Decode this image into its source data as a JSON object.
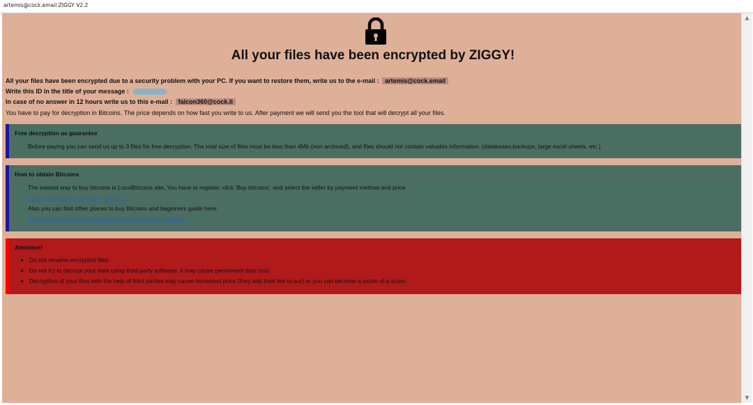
{
  "window": {
    "title": "artemis@cock.email ZIGGY V2.2"
  },
  "header": {
    "lock_icon": "padlock-icon",
    "headline": "All your files have been encrypted by ZIGGY!"
  },
  "intro": {
    "line1_text": "All your files have been encrypted due to a security problem with your PC. If you want to restore them, write us to the e-mail :",
    "line1_email": "artemis@cock.email",
    "line2_text": "Write this ID in the title of your message :",
    "line3_text": "In case of no answer in 12 hours write us to this e-mail :",
    "line3_email": "falcon360@cock.li",
    "line4_text": "You have to pay for decryption in Bitcoins. The price depends on how fast you write to us. After payment we will send you the tool that will decrypt all your files."
  },
  "free_decryption": {
    "title": "Free decryption as guarantee",
    "text": "Before paying you can send us up to 3 files for free decryption. The total size of files must be less than 4Mb (non archived), and files should not contain valuable information. (databases,backups, large excel sheets, etc.)"
  },
  "obtain_bitcoins": {
    "title": "How to obtain Bitcoins",
    "text1": "The easiest way to buy bitcoins is LocalBitcoins site. You have to register, click 'Buy bitcoins', and select the seller by payment method and price.",
    "link1": "https://localbitcoins.com/buy_bitcoins",
    "text2": "Also you can find other places to buy Bitcoins and beginners guide here:",
    "link2": "http://www.coindesk.com/information/how-can-i-buy-bitcoins/"
  },
  "attention": {
    "title": "Attention!",
    "items": [
      "Do not rename encrypted files.",
      "Do not try to decrypt your data using third party software, it may cause permanent data loss.",
      "Decryption of your files with the help of third parties may cause increased price (they add their fee to our) or you can become a victim of a scam."
    ]
  },
  "colors": {
    "background": "#dfb098",
    "info_panel": "#4b6e62",
    "info_panel_accent": "#1818a0",
    "attention_panel": "#b01a1a",
    "attention_accent": "#ff0000",
    "email_highlight": "#b98d80"
  }
}
